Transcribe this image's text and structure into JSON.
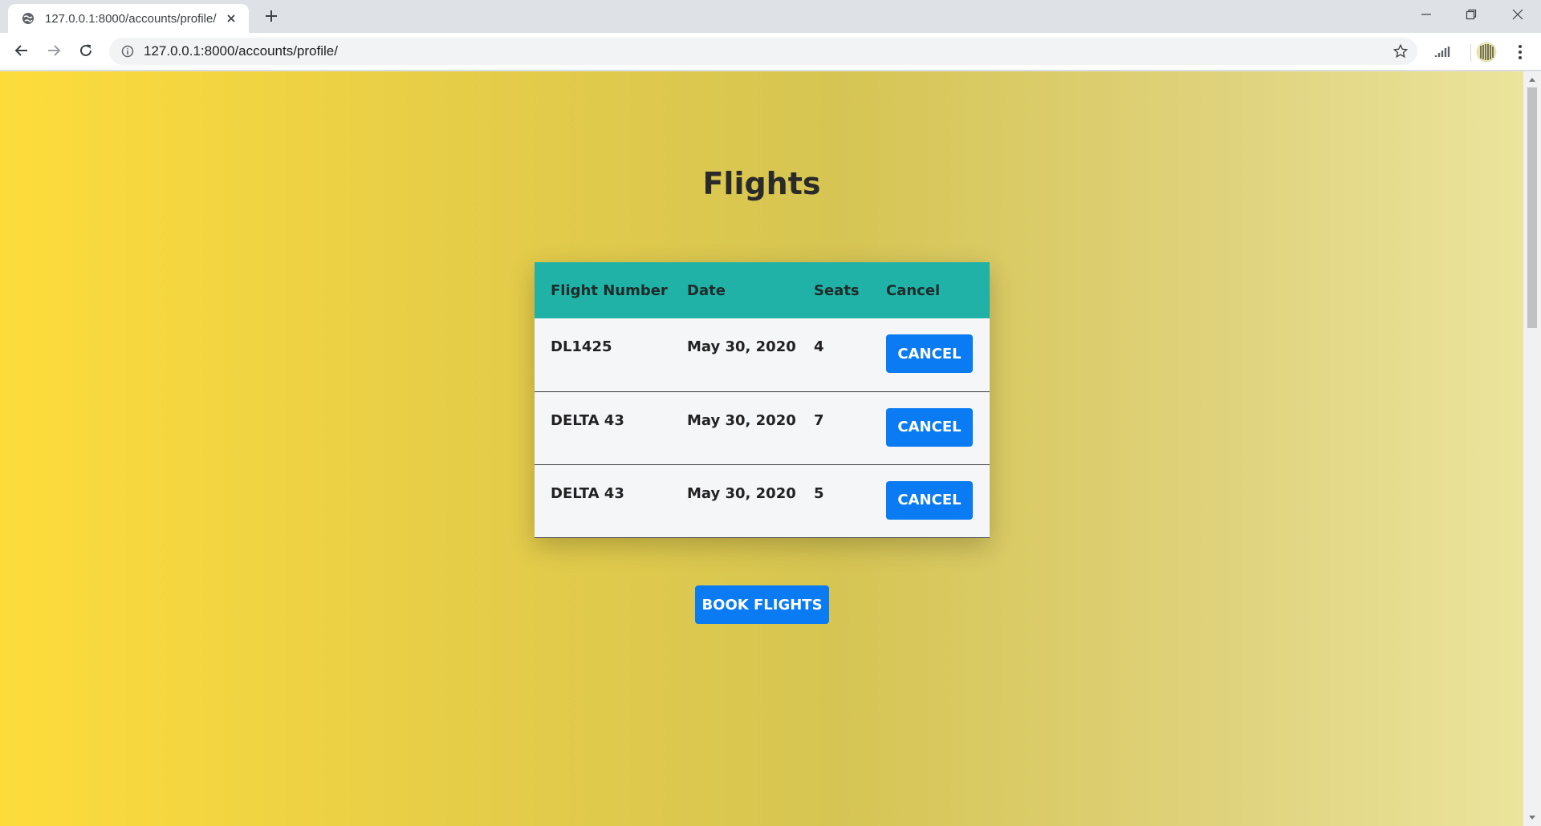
{
  "browser": {
    "tab_title": "127.0.0.1:8000/accounts/profile/",
    "url": "127.0.0.1:8000/accounts/profile/"
  },
  "page": {
    "title": "Flights",
    "table": {
      "headers": [
        "Flight Number",
        "Date",
        "Seats",
        "Cancel"
      ],
      "rows": [
        {
          "flight_number": "DL1425",
          "date": "May 30, 2020",
          "seats": "4",
          "action": "CANCEL"
        },
        {
          "flight_number": "DELTA 43",
          "date": "May 30, 2020",
          "seats": "7",
          "action": "CANCEL"
        },
        {
          "flight_number": "DELTA 43",
          "date": "May 30, 2020",
          "seats": "5",
          "action": "CANCEL"
        }
      ]
    },
    "book_button_label": "BOOK FLIGHTS"
  },
  "colors": {
    "header_teal": "#20b2a6",
    "button_blue": "#0a7bf2",
    "gradient_start": "#fddc3a",
    "gradient_end": "#ebe49c"
  },
  "icons": {
    "favicon": "globe-icon",
    "tab_close": "close-icon",
    "new_tab": "plus-icon",
    "back": "arrow-left-icon",
    "forward": "arrow-right-icon",
    "reload": "reload-icon",
    "site_info": "info-icon",
    "bookmark": "star-icon",
    "media": "media-route-icon",
    "profile": "profile-avatar-icon",
    "menu": "kebab-menu-icon"
  }
}
